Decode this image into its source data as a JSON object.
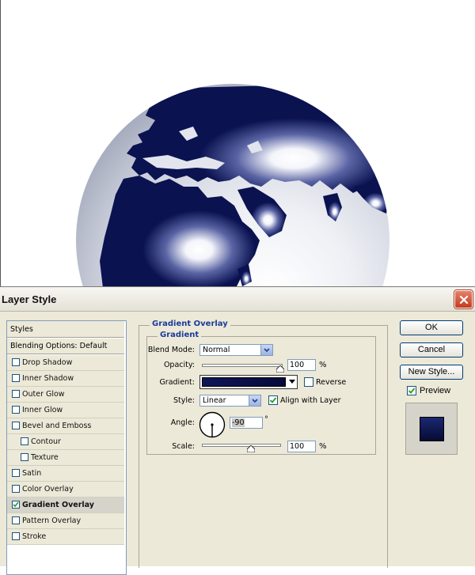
{
  "dialog": {
    "title": "Layer Style"
  },
  "styles_panel": {
    "header": "Styles",
    "blending_options": "Blending Options: Default",
    "items": [
      {
        "label": "Drop Shadow",
        "checked": false
      },
      {
        "label": "Inner Shadow",
        "checked": false
      },
      {
        "label": "Outer Glow",
        "checked": false
      },
      {
        "label": "Inner Glow",
        "checked": false
      },
      {
        "label": "Bevel and Emboss",
        "checked": false
      },
      {
        "label": "Contour",
        "checked": false
      },
      {
        "label": "Texture",
        "checked": false
      },
      {
        "label": "Satin",
        "checked": false
      },
      {
        "label": "Color Overlay",
        "checked": false
      },
      {
        "label": "Gradient Overlay",
        "checked": true
      },
      {
        "label": "Pattern Overlay",
        "checked": false
      },
      {
        "label": "Stroke",
        "checked": false
      }
    ]
  },
  "gradient_overlay": {
    "title": "Gradient Overlay",
    "group_title": "Gradient",
    "blend_mode_label": "Blend Mode:",
    "blend_mode_value": "Normal",
    "opacity_label": "Opacity:",
    "opacity_value": "100",
    "opacity_unit": "%",
    "gradient_label": "Gradient:",
    "reverse_label": "Reverse",
    "reverse_checked": false,
    "style_label": "Style:",
    "style_value": "Linear",
    "align_label": "Align with Layer",
    "align_checked": true,
    "angle_label": "Angle:",
    "angle_value": "-90",
    "angle_unit": "°",
    "scale_label": "Scale:",
    "scale_value": "100",
    "scale_unit": "%"
  },
  "buttons": {
    "ok": "OK",
    "cancel": "Cancel",
    "new_style": "New Style...",
    "preview_label": "Preview",
    "preview_checked": true
  },
  "colors": {
    "globe_dark": "#0a1250",
    "dialog_bg": "#ece9d8",
    "group_title": "#1b3b9a",
    "close_button": "#d9573a"
  },
  "icons": [
    "close-icon",
    "checkmark-icon",
    "dropdown-arrow-icon",
    "angle-dial-icon",
    "slider-thumb-icon"
  ]
}
